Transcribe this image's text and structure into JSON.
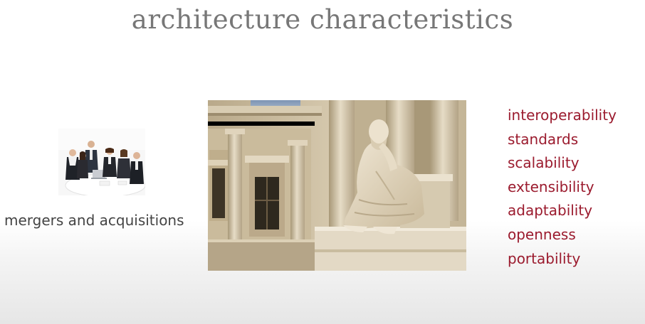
{
  "slide": {
    "title": "architecture characteristics",
    "caption": "mergers and acquisitions",
    "characteristics": [
      "interoperability",
      "standards",
      "scalability",
      "extensibility",
      "adaptability",
      "openness",
      "portability"
    ]
  },
  "colors": {
    "title": "#777777",
    "caption": "#444444",
    "list": "#9b1b2e"
  },
  "images": {
    "meeting_photo": "business-meeting-photo",
    "statue_photo": "classical-philosopher-statue-photo"
  }
}
